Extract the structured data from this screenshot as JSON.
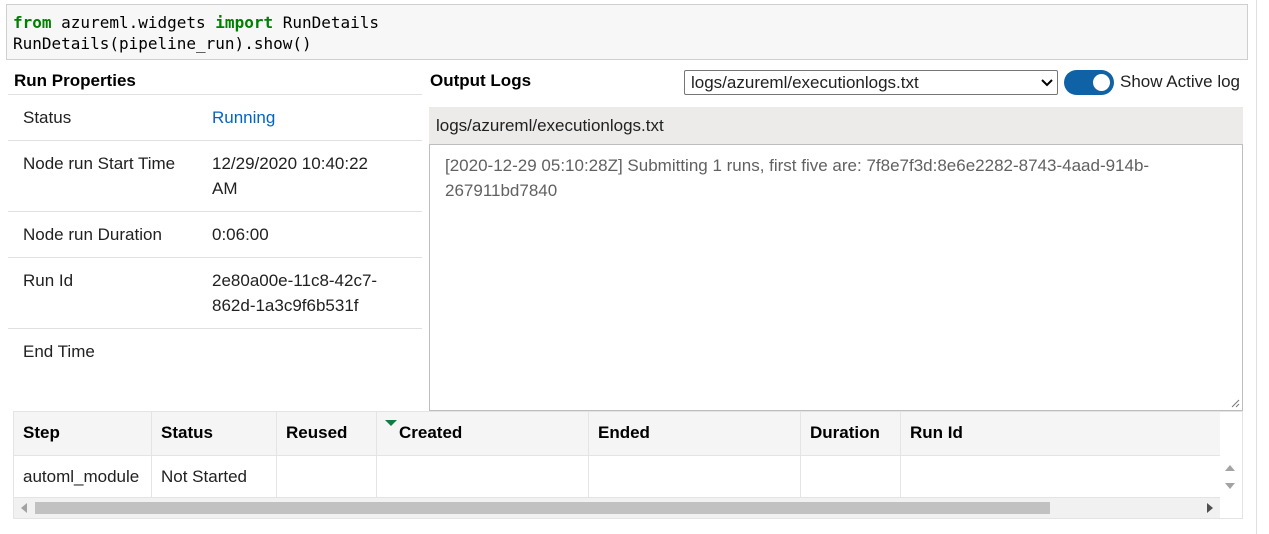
{
  "code": {
    "line1_kw1": "from",
    "line1_mid": " azureml.widgets ",
    "line1_kw2": "import",
    "line1_end": " RunDetails",
    "line2": "RunDetails(pipeline_run).show()"
  },
  "run_properties": {
    "title": "Run Properties",
    "rows": [
      {
        "key": "Status",
        "value": "Running"
      },
      {
        "key": "Node run Start Time",
        "value": "12/29/2020 10:40:22 AM"
      },
      {
        "key": "Node run Duration",
        "value": "0:06:00"
      },
      {
        "key": "Run Id",
        "value": "2e80a00e-11c8-42c7-862d-1a3c9f6b531f"
      },
      {
        "key": "End Time",
        "value": ""
      }
    ],
    "status_color": "#0563c1"
  },
  "output_logs": {
    "title": "Output Logs",
    "selected_log": "logs/azureml/executionlogs.txt",
    "toggle_label": "Show Active log",
    "toggle_on": true,
    "toggle_color": "#0f62a6",
    "log_header": "logs/azureml/executionlogs.txt",
    "log_text": "[2020-12-29 05:10:28Z] Submitting 1 runs, first five are: 7f8e7f3d:8e6e2282-8743-4aad-914b-267911bd7840"
  },
  "steps_table": {
    "columns": [
      "Step",
      "Status",
      "Reused",
      "Created",
      "Ended",
      "Duration",
      "Run Id"
    ],
    "sorted_column": "Created",
    "rows": [
      {
        "step": "automl_module",
        "status": "Not Started",
        "reused": "",
        "created": "",
        "ended": "",
        "duration": "",
        "run_id": ""
      }
    ]
  },
  "icons": {
    "select_chevron": "chevron-down-icon",
    "sort_indicator": "sort-desc-icon",
    "resize_grip": "resize-grip-icon"
  }
}
